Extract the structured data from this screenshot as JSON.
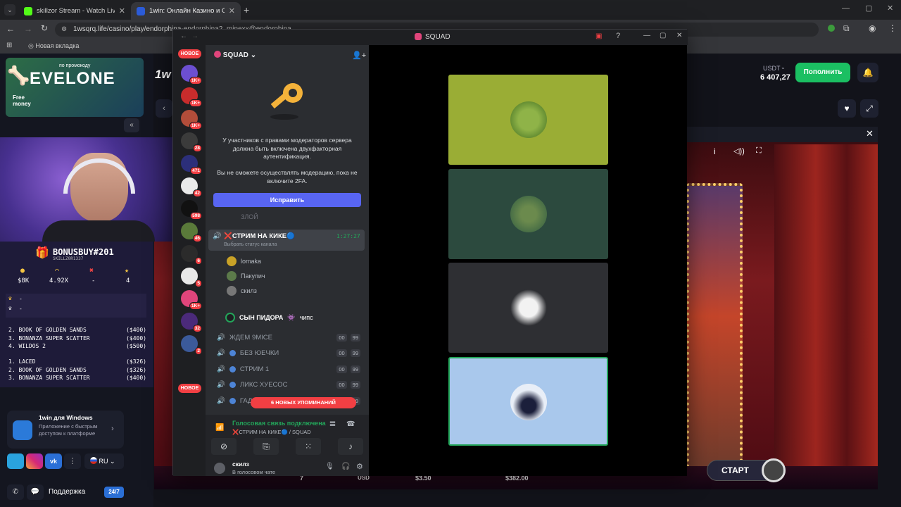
{
  "browser": {
    "tabs": [
      {
        "title": "skillzor Stream - Watch Live on"
      },
      {
        "title": "1win: Онлайн Казино и Ставки"
      }
    ],
    "url": "1wsqrq.life/casino/play/endorphina-endorphina2_minexx@endorphina",
    "bookmark": "Новая вкладка"
  },
  "site": {
    "currency": "USDT",
    "balance": "6 407,27",
    "deposit_label": "Пополнить",
    "promo": {
      "subtitle": "по промокоду",
      "code": "EVELONE",
      "free": "Free money"
    },
    "windows_app": {
      "title": "1win для Windows",
      "desc": "Приложение с быстрым доступом к платформе"
    },
    "lang": "RU",
    "support_label": "Поддержка",
    "support_badge": "24/7",
    "start_label": "СТАРТ",
    "bottom_values": [
      "7",
      "USD",
      "$3.50",
      "$382.00"
    ]
  },
  "bonus": {
    "title": "BONUSBUY#201",
    "subtitle": "SKILLZ0R1337",
    "stats": [
      "$8K",
      "4.92X",
      "-",
      "4"
    ],
    "crowns": [
      "-",
      "-"
    ],
    "list_a": [
      {
        "name": "2. BOOK OF GOLDEN SANDS",
        "val": "($400)"
      },
      {
        "name": "3. BONANZA SUPER SCATTER",
        "val": "($400)"
      },
      {
        "name": "4. WILDOS 2",
        "val": "($500)"
      }
    ],
    "list_b": [
      {
        "name": "1. LACED",
        "val": "($326)"
      },
      {
        "name": "2. BOOK OF GOLDEN SANDS",
        "val": "($326)"
      },
      {
        "name": "3. BONANZA SUPER SCATTER",
        "val": "($400)"
      }
    ]
  },
  "discord": {
    "window_title": "SQUAD",
    "server_name": "SQUAD",
    "new_label": "НОВОЕ",
    "server_badges": [
      "1K+",
      "1K+",
      "1K+",
      "28",
      "471",
      "42",
      "598",
      "46",
      "6",
      "5",
      "1K+",
      "32",
      "2"
    ],
    "mod_notice": "У участников с правами модераторов сервера должна быть включена двухфакторная аутентификация.",
    "mod_notice2": "Вы не сможете осуществлять модерацию, пока не включите 2FA.",
    "fix_label": "Исправить",
    "faded_user": "ЗЛОЙ",
    "live_channel": "❌СТРИМ НА КИКЕ🔵",
    "live_time": "1:27:27",
    "status_hint": "Выбрать статус канала",
    "users": [
      "lomaka",
      "Пакупич",
      "скилз"
    ],
    "speaker": "СЫН ПИДОРА",
    "speaker_tag": "чипс",
    "channels": [
      {
        "name": "ЖДЕМ 9MICE"
      },
      {
        "name": "БЕЗ ЮЕЧКИ"
      },
      {
        "name": "СТРИМ 1"
      },
      {
        "name": "ЛИКС ХУЕСОС"
      },
      {
        "name": "ГАД"
      }
    ],
    "pill_a": "00",
    "pill_b": "99",
    "mentions": "6 НОВЫХ УПОМИНАНИЙ",
    "voice_status": "Голосовая связь подключена",
    "voice_channel": "❌СТРИМ НА КИКЕ🔵 / SQUAD",
    "me_name": "скилз",
    "me_status": "В голосовом чате"
  },
  "colors": {
    "accent": "#5865f2",
    "green": "#23a55a",
    "red": "#f23f43",
    "deposit": "#1bbf62"
  }
}
